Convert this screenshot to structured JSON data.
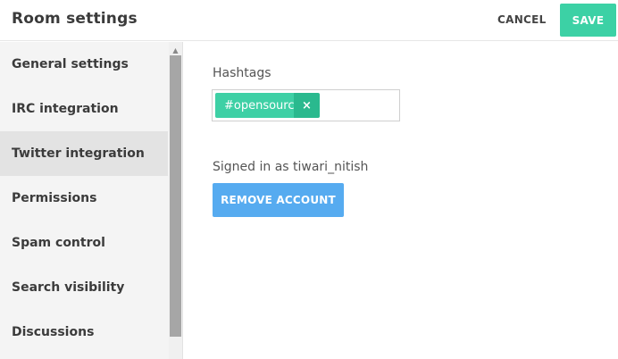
{
  "header": {
    "title": "Room settings",
    "cancel_label": "CANCEL",
    "save_label": "SAVE"
  },
  "sidebar": {
    "items": [
      {
        "label": "General settings",
        "active": false
      },
      {
        "label": "IRC integration",
        "active": false
      },
      {
        "label": "Twitter integration",
        "active": true
      },
      {
        "label": "Permissions",
        "active": false
      },
      {
        "label": "Spam control",
        "active": false
      },
      {
        "label": "Search visibility",
        "active": false
      },
      {
        "label": "Discussions",
        "active": false
      }
    ]
  },
  "main": {
    "hashtags_label": "Hashtags",
    "tags": [
      {
        "text": "#opensource",
        "remove_icon": "×"
      }
    ],
    "signed_in_text": "Signed in as tiwari_nitish",
    "remove_account_label": "REMOVE ACCOUNT"
  },
  "colors": {
    "save": "#3cd1a5",
    "tag": "#3ed0a5",
    "tag_remove": "#2ab98e",
    "remove_account": "#56abf0"
  }
}
